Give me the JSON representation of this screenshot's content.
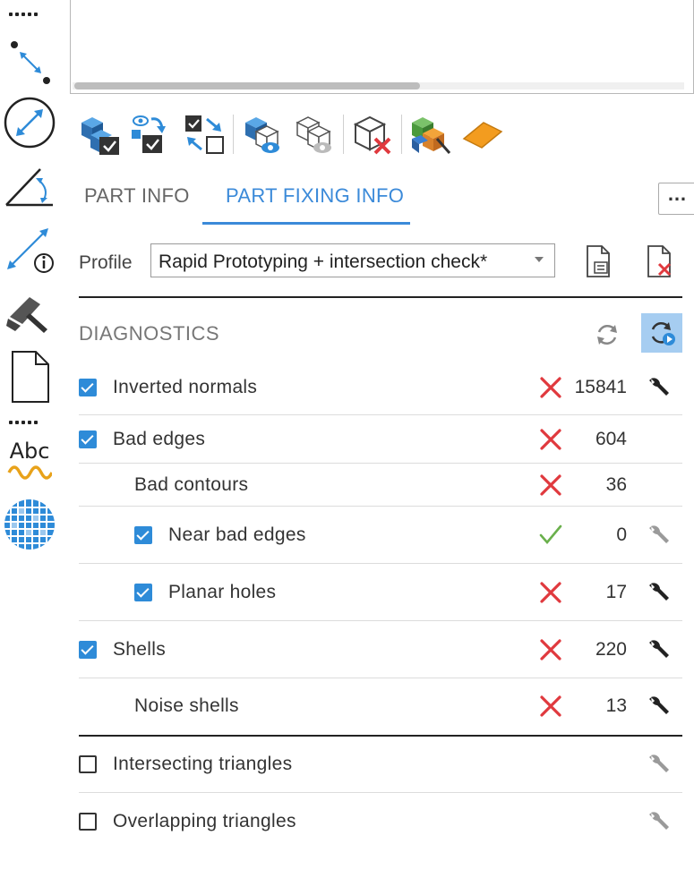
{
  "left_tools": [
    {
      "icon": "dot-distance-icon"
    },
    {
      "icon": "circle-diameter-icon"
    },
    {
      "icon": "angle-measure-icon"
    },
    {
      "icon": "measure-info-icon"
    },
    {
      "icon": "hammer-icon"
    },
    {
      "icon": "blank-page-icon"
    },
    {
      "icon": "text-annotation-icon",
      "text": "Abc"
    },
    {
      "icon": "texture-sphere-icon"
    }
  ],
  "toolbar": {
    "icons": [
      "select-parts-icon",
      "select-visible-icon",
      "invert-selection-icon",
      "show-selected-icon",
      "hide-selected-icon",
      "delete-part-icon",
      "color-parts-icon",
      "surface-icon"
    ]
  },
  "tabs": [
    {
      "label": "PART INFO",
      "active": false
    },
    {
      "label": "PART FIXING INFO",
      "active": true
    }
  ],
  "more_button": "…",
  "profile": {
    "label": "Profile",
    "value": "Rapid Prototyping + intersection check*"
  },
  "diagnostics": {
    "title": "DIAGNOSTICS",
    "rows": [
      {
        "label": "Inverted normals",
        "checkbox": "on",
        "status": "error",
        "count": "15841",
        "wrench": true,
        "wrench_dim": false
      },
      {
        "label": "Bad edges",
        "checkbox": "on",
        "status": "error",
        "count": "604",
        "wrench": false
      },
      {
        "label": "Bad contours",
        "checkbox": "none",
        "status": "error",
        "count": "36",
        "wrench": false
      },
      {
        "label": "Near bad edges",
        "checkbox": "on",
        "status": "ok",
        "count": "0",
        "wrench": true,
        "wrench_dim": true
      },
      {
        "label": "Planar holes",
        "checkbox": "on",
        "status": "error",
        "count": "17",
        "wrench": true,
        "wrench_dim": false
      },
      {
        "label": "Shells",
        "checkbox": "on",
        "status": "error",
        "count": "220",
        "wrench": true,
        "wrench_dim": false
      },
      {
        "label": "Noise shells",
        "checkbox": "none",
        "status": "error",
        "count": "13",
        "wrench": true,
        "wrench_dim": false
      },
      {
        "label": "Intersecting triangles",
        "checkbox": "off",
        "status": "none",
        "count": "",
        "wrench": true,
        "wrench_dim": true
      },
      {
        "label": "Overlapping triangles",
        "checkbox": "off",
        "status": "none",
        "count": "",
        "wrench": true,
        "wrench_dim": true
      }
    ]
  },
  "colors": {
    "accent": "#3b8ad9",
    "checkbox": "#2e8bd8",
    "error": "#e0393e",
    "ok": "#6ab04c"
  }
}
